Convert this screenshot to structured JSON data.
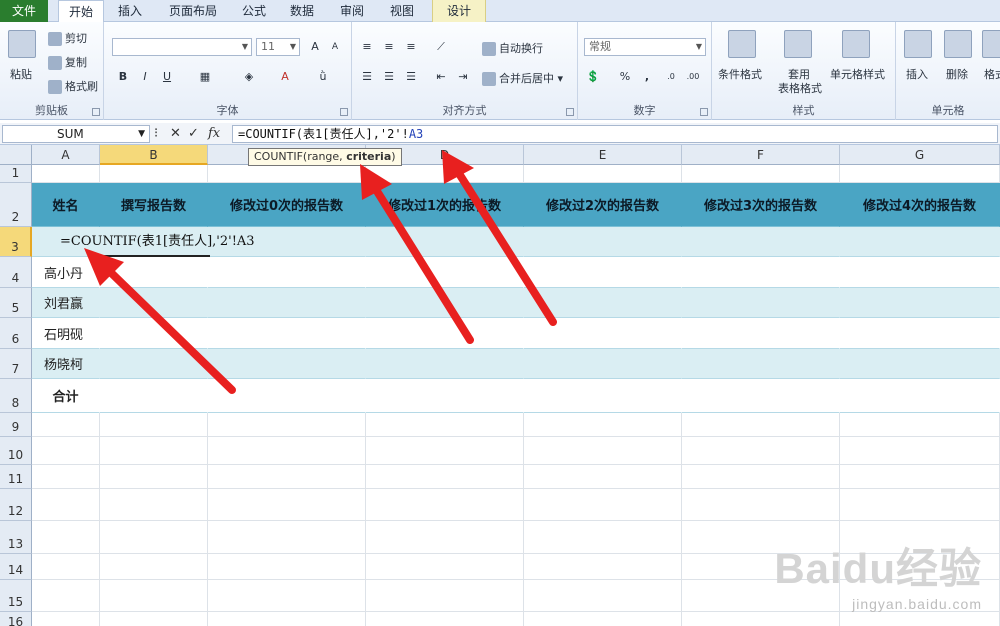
{
  "ribbon": {
    "tabs": [
      "文件",
      "开始",
      "插入",
      "页面布局",
      "公式",
      "数据",
      "审阅",
      "视图",
      "设计"
    ],
    "clipboard": {
      "paste": "粘贴",
      "cut": "剪切",
      "copy": "复制",
      "format_painter": "格式刷",
      "label": "剪贴板"
    },
    "font": {
      "font_name": "",
      "font_size": "11",
      "label": "字体"
    },
    "alignment": {
      "wrap_text": "自动换行",
      "merge_center": "合并后居中",
      "label": "对齐方式"
    },
    "number": {
      "format": "常规",
      "percent": "%",
      "comma": ",",
      "label": "数字"
    },
    "styles": {
      "conditional": "条件格式",
      "table_format_1": "套用",
      "table_format_2": "表格格式",
      "cell_styles": "单元格样式",
      "label": "样式"
    },
    "cells": {
      "insert": "插入",
      "delete": "删除",
      "format": "格式",
      "label": "单元格"
    }
  },
  "formula_bar": {
    "name_box": "SUM",
    "fx": "fx",
    "formula_prefix": "=COUNTIF(表1[责任人],'2'!",
    "formula_ref": "A3"
  },
  "tooltip": {
    "func": "COUNTIF(range, ",
    "arg": "criteria",
    "close": ")"
  },
  "columns": [
    "A",
    "B",
    "C",
    "D",
    "E",
    "F",
    "G"
  ],
  "rows": [
    "1",
    "2",
    "3",
    "4",
    "5",
    "6",
    "7",
    "8",
    "9",
    "10",
    "11",
    "12",
    "13",
    "14",
    "15",
    "16"
  ],
  "header_row": [
    "姓名",
    "撰写报告数",
    "修改过0次的报告数",
    "修改过1次的报告数",
    "修改过2次的报告数",
    "修改过3次的报告数",
    "修改过4次的报告数"
  ],
  "editing_cell_text": "=COUNTIF(表1[责任人],'2'!A3",
  "names": [
    "高小丹",
    "刘君赢",
    "石明砚",
    "杨晓柯"
  ],
  "total_label": "合计",
  "watermark": {
    "brand": "Baidu经验",
    "url": "jingyan.baidu.com"
  },
  "colors": {
    "header_fill": "#4aa5c4",
    "band_fill": "#daeef3",
    "arrow": "#e8201f",
    "selected_header": "#f5d97a"
  }
}
